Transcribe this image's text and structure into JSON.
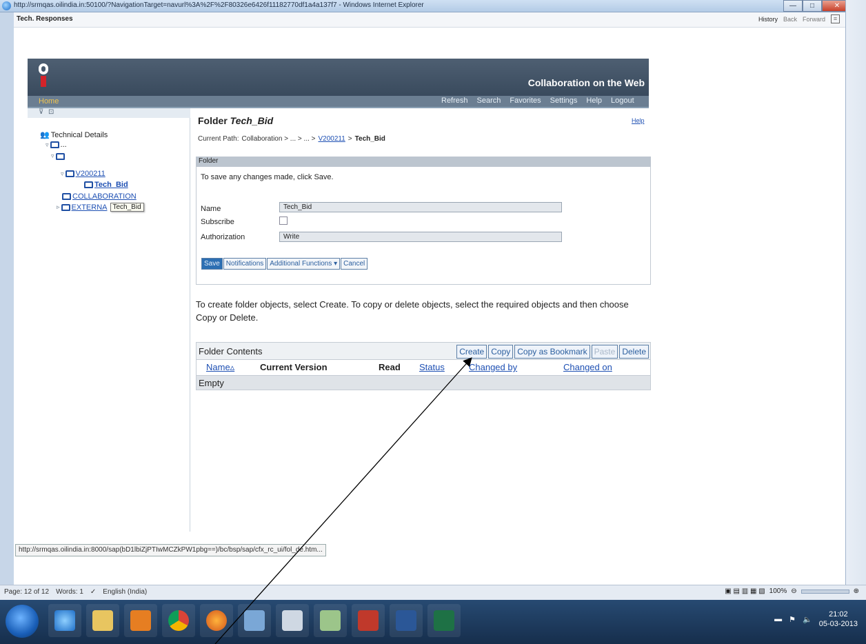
{
  "browser": {
    "title": "http://srmqas.oilindia.in:50100/?NavigationTarget=navurl%3A%2F%2F80326e6426f11182770df1a4a137f7 - Windows Internet Explorer",
    "tab_title": "Tech. Responses",
    "history_label": "History",
    "back_label": "Back",
    "forward_label": "Forward",
    "status_url": "http://srmqas.oilindia.in:8000/sap(bD1lbiZjPTIwMCZkPW1pbg==)/bc/bsp/sap/cfx_rc_ui/fol_de.htm..."
  },
  "portal": {
    "title": "Collaboration on the Web",
    "home_label": "Home",
    "nav": [
      "Refresh",
      "Search",
      "Favorites",
      "Settings",
      "Help",
      "Logout"
    ]
  },
  "tree": {
    "root_label": "Technical Details",
    "node_ellipsis": "...",
    "v200211": "V200211",
    "tech_bid": "Tech_Bid",
    "collaboration": "COLLABORATION",
    "externa": "EXTERNA",
    "tooltip": "Tech_Bid"
  },
  "folder": {
    "heading_prefix": "Folder",
    "heading_name": "Tech_Bid",
    "help_label": "Help",
    "path_prefix": "Current Path:",
    "path_collab": "Collaboration > ... > ... >",
    "path_link": "V200211",
    "path_sep": ">",
    "path_current": "Tech_Bid",
    "section_title": "Folder",
    "save_hint": "To save any changes made, click Save.",
    "name_label": "Name",
    "name_value": "Tech_Bid",
    "subscribe_label": "Subscribe",
    "authorization_label": "Authorization",
    "authorization_value": "Write",
    "buttons": {
      "save": "Save",
      "notifications": "Notifications",
      "additional": "Additional Functions ▾",
      "cancel": "Cancel"
    }
  },
  "instructions": "To create folder objects, select Create. To copy or delete objects, select the required objects and then choose Copy or Delete.",
  "contents": {
    "title": "Folder Contents",
    "buttons": [
      "Create",
      "Copy",
      "Copy as Bookmark",
      "Paste",
      "Delete"
    ],
    "columns": [
      "Name▵",
      "Current Version",
      "Read",
      "Status",
      "Changed by",
      "Changed on"
    ],
    "empty": "Empty"
  },
  "word": {
    "page": "Page: 12 of 12",
    "words": "Words: 1",
    "language": "English (India)",
    "zoom": "100%"
  },
  "clock": {
    "time": "21:02",
    "date": "05-03-2013"
  },
  "colors": {
    "portal_header": "#43546a",
    "nav_bar": "#6b7e92",
    "link": "#1d4fb3",
    "primary_button": "#2c6fb3",
    "taskbar": "#1e3c60"
  }
}
